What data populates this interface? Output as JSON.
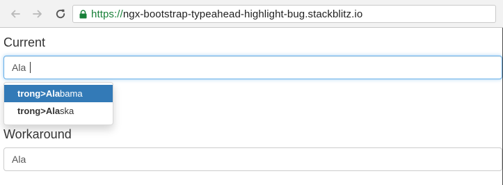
{
  "browser": {
    "url_scheme": "https://",
    "url_host": "ngx-bootstrap-typeahead-highlight-bug.stackblitz.io",
    "icons": {
      "back": "back-arrow-icon",
      "forward": "forward-arrow-icon",
      "reload": "reload-icon",
      "secure": "lock-icon"
    },
    "colors": {
      "secure": "#188038"
    }
  },
  "current": {
    "title": "Current",
    "input_value": "Ala",
    "suggestions": [
      {
        "prefix": "trong>",
        "match": "Ala",
        "rest": "bama",
        "active": true
      },
      {
        "prefix": "trong>",
        "match": "Ala",
        "rest": "ska",
        "active": false
      }
    ]
  },
  "workaround": {
    "title": "Workaround",
    "input_value": "Ala"
  },
  "colors": {
    "active_item": "#337ab7",
    "focus_border": "#66afe9"
  }
}
